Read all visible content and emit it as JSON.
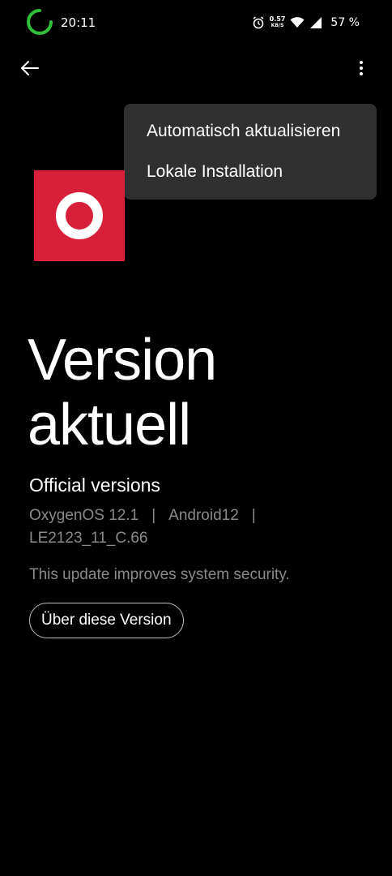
{
  "status_bar": {
    "time": "20:11",
    "net_speed_value": "0.57",
    "net_speed_unit": "KB/S",
    "battery": "57 %",
    "icons": [
      "loading-spinner-icon",
      "alarm-icon",
      "wifi-icon",
      "cell-signal-icon"
    ]
  },
  "toolbar": {
    "back_icon": "arrow-left-icon",
    "more_icon": "more-vert-icon"
  },
  "menu": {
    "items": [
      {
        "label": "Automatisch aktualisieren"
      },
      {
        "label": "Lokale Installation"
      }
    ]
  },
  "logo": {
    "brand_color": "#d8203a",
    "ring_color": "#ffffff"
  },
  "main": {
    "headline_line1": "Version",
    "headline_line2": "aktuell",
    "section_title": "Official versions",
    "os_version": "OxygenOS 12.1",
    "android_version": "Android12",
    "separator": "|",
    "build": "LE2123_11_C.66",
    "description": "This update improves system security.",
    "about_button": "Über diese Version"
  },
  "colors": {
    "background": "#000000",
    "menu_background": "#303030",
    "secondary_text": "#8a8a8a",
    "spinner": "#2fbf3a"
  }
}
